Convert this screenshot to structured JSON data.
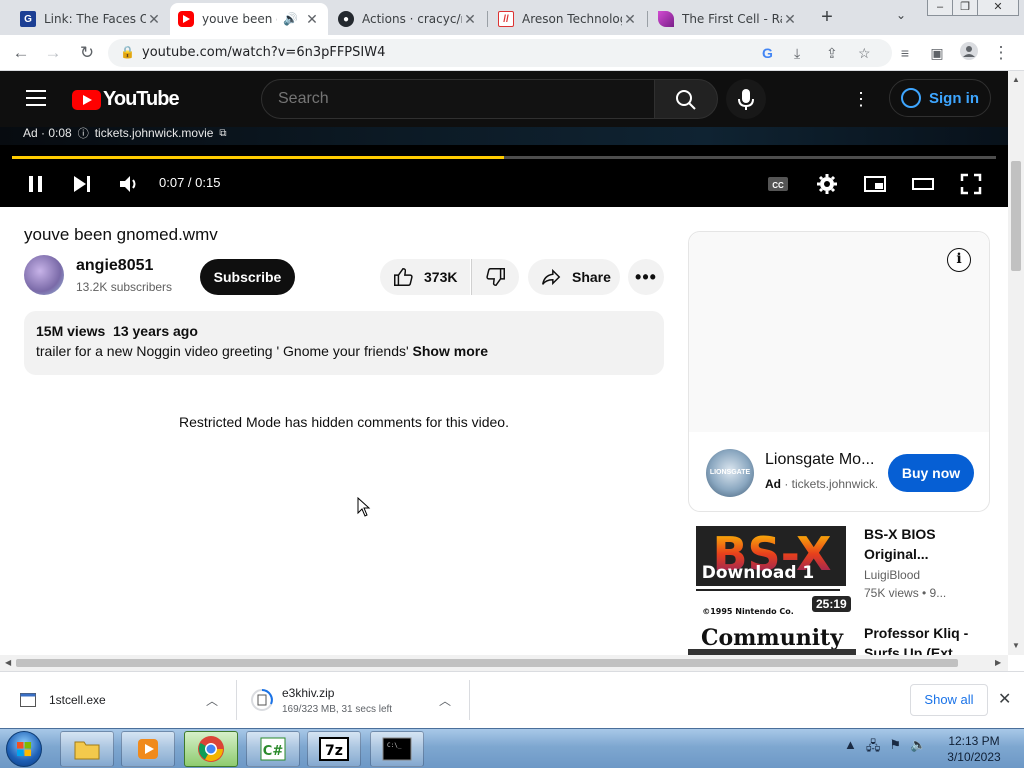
{
  "browser": {
    "tabs": [
      {
        "title": "Link: The Faces Of",
        "active": false
      },
      {
        "title": "youve been gnomed",
        "active": true
      },
      {
        "title": "Actions · cracyc/m",
        "active": false
      },
      {
        "title": "Areson Technology",
        "active": false
      },
      {
        "title": "The First Cell - Ra",
        "active": false
      }
    ],
    "url": "youtube.com/watch?v=6n3pFFPSIW4"
  },
  "youtube": {
    "logo_text": "YouTube",
    "search_placeholder": "Search",
    "sign_in": "Sign in"
  },
  "player": {
    "ad_label": "Ad · 0:08",
    "ad_domain": "tickets.johnwick.movie",
    "time": "0:07 / 0:15",
    "progress": 0.5
  },
  "video": {
    "title": "youve been gnomed.wmv",
    "channel": "angie8051",
    "subscribers": "13.2K subscribers",
    "subscribe_label": "Subscribe",
    "likes": "373K",
    "share_label": "Share",
    "views": "15M views",
    "age": "13 years ago",
    "description": "trailer for a new Noggin video greeting ' Gnome your friends'",
    "show_more": "Show more",
    "comments_notice": "Restricted Mode has hidden comments for this video."
  },
  "sidebar": {
    "ad": {
      "name": "Lionsgate Mo...",
      "ad_tag": "Ad",
      "domain": "tickets.johnwick.movie",
      "logo_text": "LIONSGATE",
      "cta": "Buy now"
    },
    "recommendations": [
      {
        "title": "BS-X BIOS Original...",
        "channel": "LuigiBlood",
        "views": "75K views • 9...",
        "duration": "25:19",
        "thumb_headline": "BS-X",
        "thumb_subline": "Download 1",
        "thumb_caption": "©1995 Nintendo Co."
      },
      {
        "title": "Professor Kliq - Surfs Up (Ext...",
        "thumb_headline": "Community"
      }
    ]
  },
  "downloads": [
    {
      "name": "1stcell.exe",
      "status": ""
    },
    {
      "name": "e3khiv.zip",
      "status": "169/323 MB, 31 secs left"
    }
  ],
  "shelf": {
    "show_all": "Show all"
  },
  "taskbar": {
    "apps": [
      "Explorer",
      "Media Player",
      "Chrome",
      "C#",
      "7z",
      "Command Prompt"
    ],
    "time": "12:13 PM",
    "date": "3/10/2023"
  }
}
